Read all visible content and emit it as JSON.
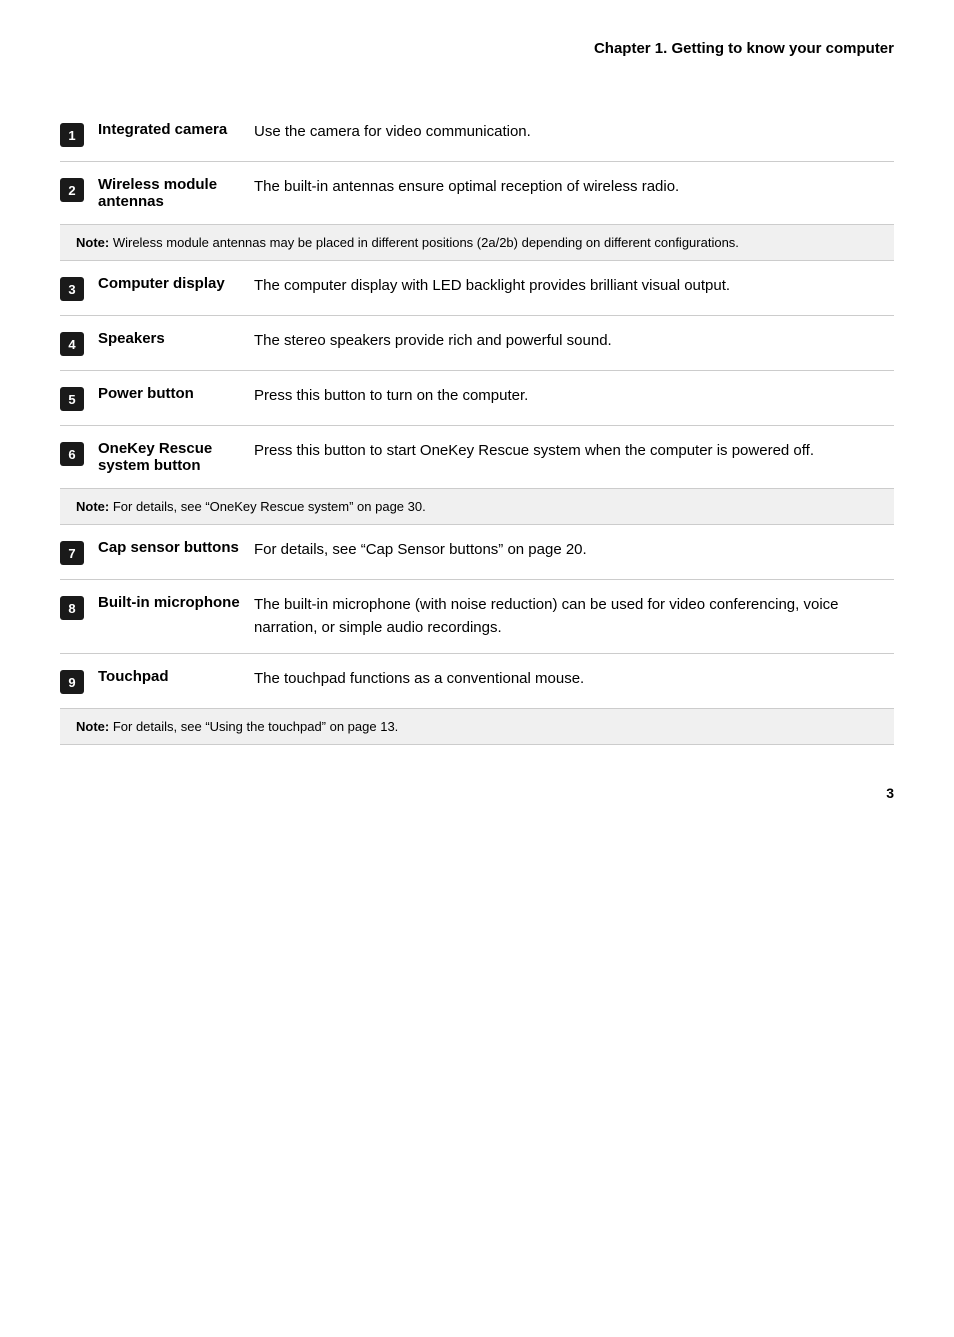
{
  "header": {
    "title": "Chapter 1. Getting to know your computer"
  },
  "items": [
    {
      "id": "1",
      "name": "Integrated camera",
      "description": "Use the camera for video communication.",
      "note": null
    },
    {
      "id": "2",
      "name": "Wireless module antennas",
      "description": "The built-in antennas ensure optimal reception of wireless radio.",
      "note": "Note: Wireless module antennas may be placed in different positions (2a/2b) depending on different configurations."
    },
    {
      "id": "3",
      "name": "Computer display",
      "description": "The computer display with LED backlight provides brilliant visual output.",
      "note": null
    },
    {
      "id": "4",
      "name": "Speakers",
      "description": "The stereo speakers provide rich and powerful sound.",
      "note": null
    },
    {
      "id": "5",
      "name": "Power button",
      "description": "Press this button to turn on the computer.",
      "note": null
    },
    {
      "id": "6",
      "name": "OneKey Rescue system button",
      "description": "Press this button to start OneKey Rescue system when the computer is powered off.",
      "note": "Note: For details, see “OneKey Rescue system” on page 30."
    },
    {
      "id": "7",
      "name": "Cap sensor buttons",
      "description": "For details, see “Cap Sensor buttons” on page 20.",
      "note": null
    },
    {
      "id": "8",
      "name": "Built-in microphone",
      "description": "The built-in microphone (with noise reduction) can be used for video conferencing, voice narration, or simple audio recordings.",
      "note": null
    },
    {
      "id": "9",
      "name": "Touchpad",
      "description": "The touchpad functions as a conventional mouse.",
      "note": "Note: For details, see “Using the touchpad” on page 13."
    }
  ],
  "page_number": "3"
}
